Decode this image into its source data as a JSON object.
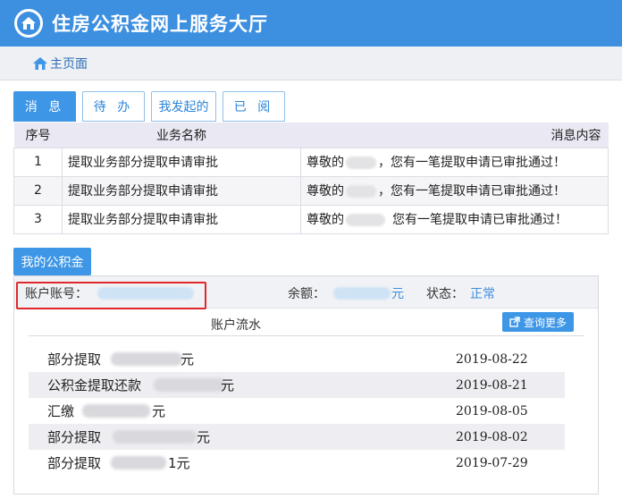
{
  "header": {
    "title": "住房公积金网上服务大厅"
  },
  "nav": {
    "home_label": "主页面"
  },
  "tabs": [
    {
      "label": "消 息",
      "active": true
    },
    {
      "label": "待 办",
      "active": false
    },
    {
      "label": "我发起的",
      "active": false
    },
    {
      "label": "已 阅",
      "active": false
    }
  ],
  "messages": {
    "headers": {
      "index": "序号",
      "business": "业务名称",
      "content": "消息内容"
    },
    "rows": [
      {
        "index": "1",
        "business": "提取业务部分提取申请审批",
        "prefix": "尊敬的",
        "suffix": "，您有一笔提取申请已审批通过！"
      },
      {
        "index": "2",
        "business": "提取业务部分提取申请审批",
        "prefix": "尊敬的",
        "suffix": "，您有一笔提取申请已审批通过！"
      },
      {
        "index": "3",
        "business": "提取业务部分提取申请审批",
        "prefix": "尊敬的",
        "suffix": "您有一笔提取申请已审批通过！"
      }
    ]
  },
  "fund": {
    "tab_label": "我的公积金",
    "account_label": "账户账号：",
    "balance_label": "余额：",
    "balance_unit": "元",
    "status_label": "状态：",
    "status_value": "正常",
    "flow_title": "账户流水",
    "more_label": "查询更多",
    "flows": [
      {
        "desc": "部分提取",
        "unit": "元",
        "date": "2019-08-22"
      },
      {
        "desc": "公积金提取还款",
        "unit": "元",
        "date": "2019-08-21"
      },
      {
        "desc": "汇缴",
        "unit": "元",
        "date": "2019-08-05"
      },
      {
        "desc": "部分提取",
        "unit": "元",
        "date": "2019-08-02"
      },
      {
        "desc": "部分提取",
        "unit": "1元",
        "date": "2019-07-29"
      }
    ]
  },
  "colors": {
    "primary": "#3d8fe0",
    "highlight": "#e0272b"
  }
}
